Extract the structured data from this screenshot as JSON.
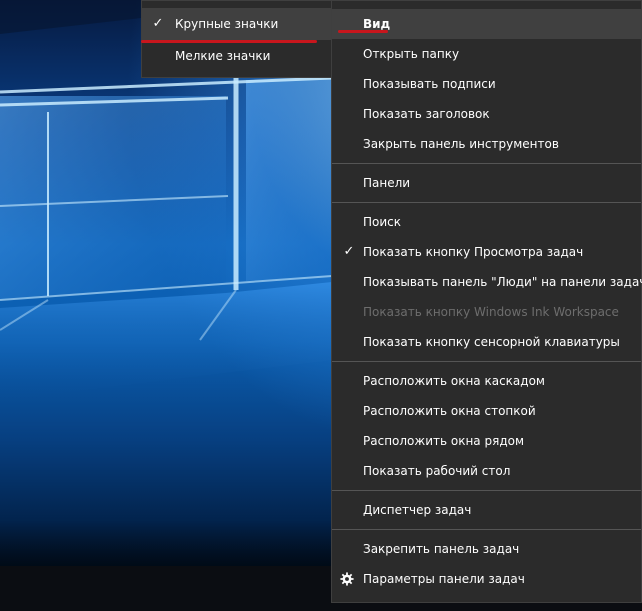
{
  "submenu": {
    "items": [
      {
        "label": "Крупные значки",
        "checked": true
      },
      {
        "label": "Мелкие значки",
        "checked": false
      }
    ]
  },
  "context_menu": {
    "view": "Вид",
    "open_folder": "Открыть папку",
    "show_labels": "Показывать подписи",
    "show_title": "Показать заголовок",
    "close_toolbar": "Закрыть панель инструментов",
    "panels": "Панели",
    "search": "Поиск",
    "show_task_view": "Показать кнопку Просмотра задач",
    "show_people": "Показывать панель \"Люди\" на панели задач",
    "show_ink": "Показать кнопку Windows Ink Workspace",
    "show_keyboard": "Показать кнопку сенсорной клавиатуры",
    "cascade": "Расположить окна каскадом",
    "stack": "Расположить окна стопкой",
    "side_by_side": "Расположить окна рядом",
    "show_desktop": "Показать рабочий стол",
    "task_manager": "Диспетчер задач",
    "lock_taskbar": "Закрепить панель задач",
    "taskbar_settings": "Параметры панели задач"
  },
  "icons": {
    "check": "✓",
    "settings": "gear-icon"
  },
  "colors": {
    "menu_bg": "#2b2b2b",
    "highlight": "#404040",
    "disabled_text": "#6d6d6d",
    "annotation_red": "#c8161d"
  }
}
